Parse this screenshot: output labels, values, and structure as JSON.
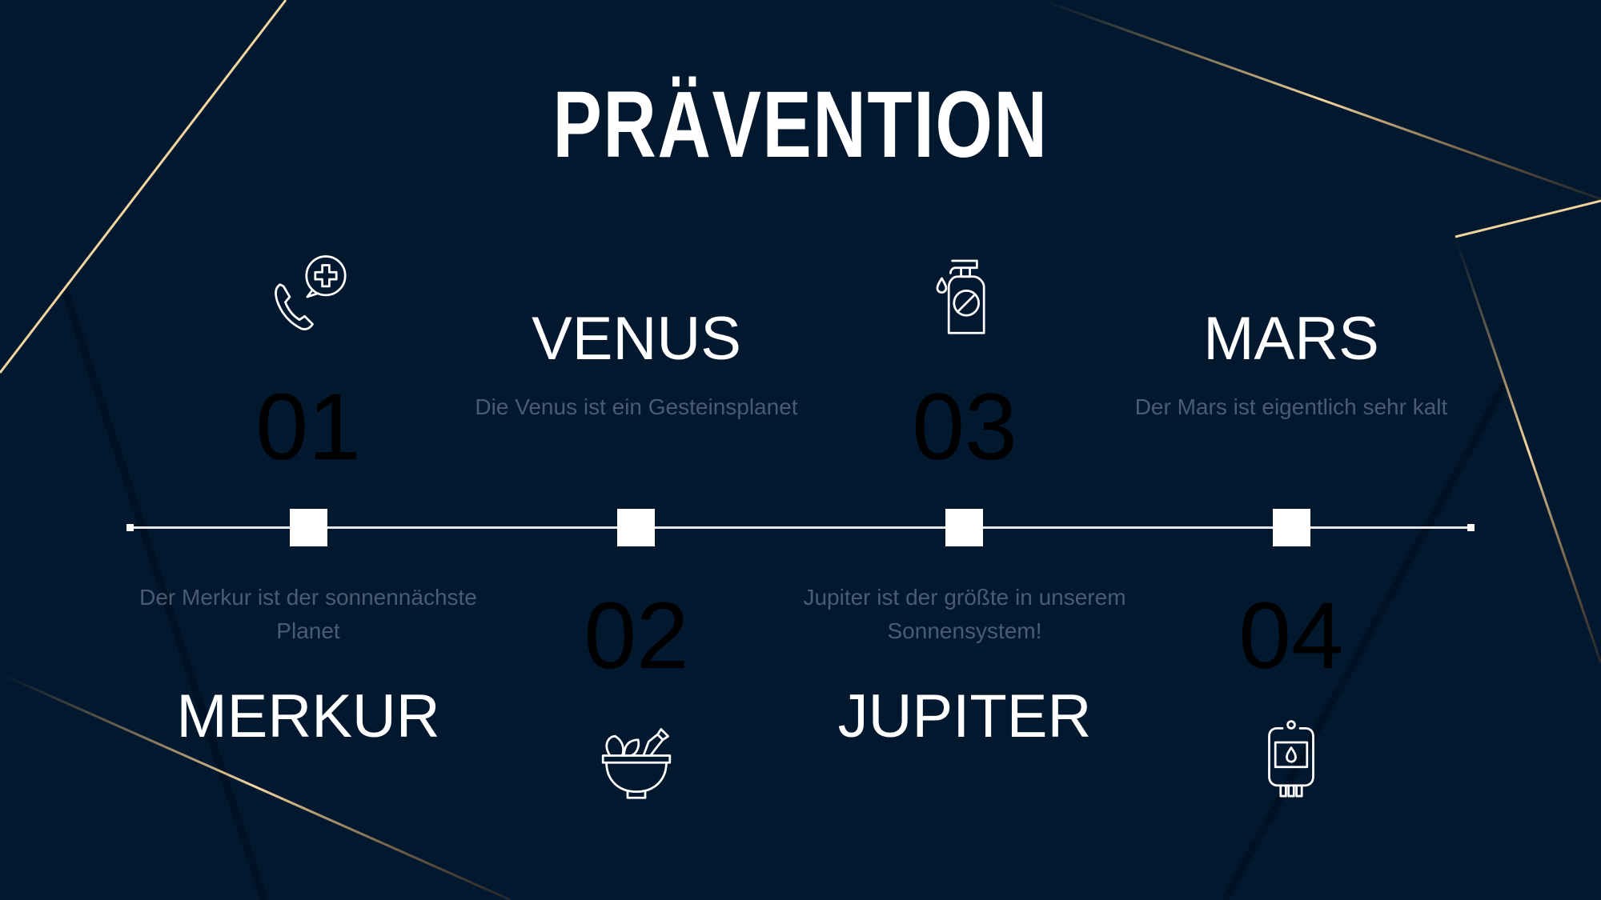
{
  "title": "PRÄVENTION",
  "items": [
    {
      "number": "01",
      "name": "MERKUR",
      "description": "Der Merkur ist der sonnennächste Planet",
      "icon": "phone-medical-icon"
    },
    {
      "number": "02",
      "name": "VENUS",
      "description": "Die Venus ist ein Gesteinsplanet",
      "icon": "mortar-herbs-icon"
    },
    {
      "number": "03",
      "name": "JUPITER",
      "description": "Jupiter ist der größte in unserem Sonnensystem!",
      "icon": "sanitizer-bottle-icon"
    },
    {
      "number": "04",
      "name": "MARS",
      "description": "Der Mars ist eigentlich sehr kalt",
      "icon": "blood-bag-icon"
    }
  ],
  "colors": {
    "background": "#01182f",
    "accent": "#c8924a"
  }
}
